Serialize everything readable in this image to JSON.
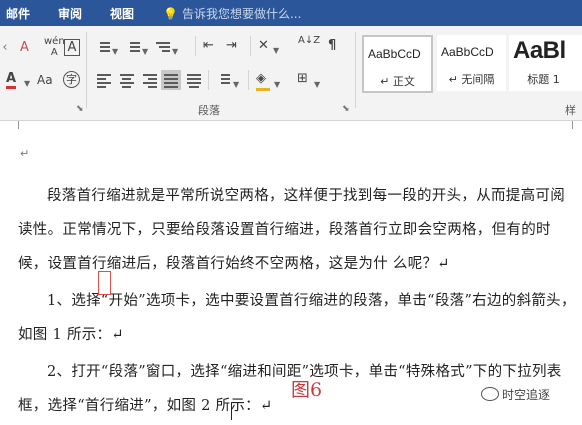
{
  "tabs": [
    "邮件",
    "审阅",
    "视图"
  ],
  "tell_me": "告诉我您想要做什么...",
  "ribbon": {
    "font_tools": {
      "clear_format": "A",
      "phonetic": "wén\nA",
      "char_border": "A",
      "font_color": "A",
      "highlight": "Aa",
      "enclose": "字"
    },
    "paragraph_label": "段落",
    "sort": "A↓Z"
  },
  "styles": [
    {
      "sample": "AaBbCcD",
      "name": "↵ 正文"
    },
    {
      "sample": "AaBbCcD",
      "name": "↵ 无间隔"
    },
    {
      "sample": "AaBl",
      "name": "标题 1"
    }
  ],
  "styles_label_partial": "样",
  "document": {
    "paragraphs": [
      "段落首行缩进就是平常所说空两格，这样便于找到每一段的开头，从而提高可阅读性。正常情况下，只要给段落设置首行缩进，段落首行立即会空两格，但有的时候，设置首行缩进后，段落首行始终不空两格，这是为什 么呢？↵",
      "1、选择“开始”选项卡，选中要设置首行缩进的段落，单击“段落”右边的斜箭头，如图 1 所示：↵",
      "2、打开“段落”窗口，选择“缩进和间距”选项卡，单击“特殊格式”下的下拉列表框，选择“首行缩进”，如图 2 所示：↵"
    ],
    "figure_label": "图6",
    "watermark": "时空追逐"
  }
}
